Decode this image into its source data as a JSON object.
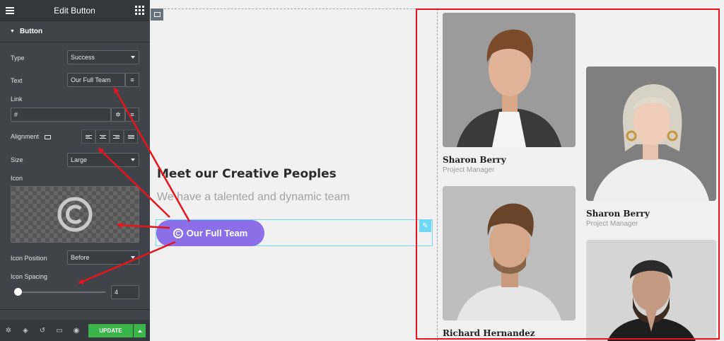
{
  "sidebar": {
    "header_title": "Edit Button",
    "section_title": "Button",
    "type": {
      "label": "Type",
      "value": "Success"
    },
    "text": {
      "label": "Text",
      "value": "Our Full Team"
    },
    "link": {
      "label": "Link",
      "value": "#"
    },
    "alignment": {
      "label": "Alignment"
    },
    "size": {
      "label": "Size",
      "value": "Large"
    },
    "icon": {
      "label": "Icon"
    },
    "icon_position": {
      "label": "Icon Position",
      "value": "Before"
    },
    "icon_spacing": {
      "label": "Icon Spacing",
      "value": "4"
    },
    "update_label": "UPDATE"
  },
  "canvas": {
    "heading": "Meet our Creative Peoples",
    "subtext": "We have a talented and dynamic team",
    "button_label": "Our Full Team"
  },
  "team": [
    {
      "name": "Sharon Berry",
      "role": "Project Manager"
    },
    {
      "name": "Sharon Berry",
      "role": "Project Manager"
    },
    {
      "name": "Richard Hernandez",
      "role": ""
    }
  ],
  "colors": {
    "accent_button": "#8b6ee8",
    "update_green": "#39b54a",
    "annotation_red": "#e8141c",
    "selection_blue": "#71d7f7"
  }
}
